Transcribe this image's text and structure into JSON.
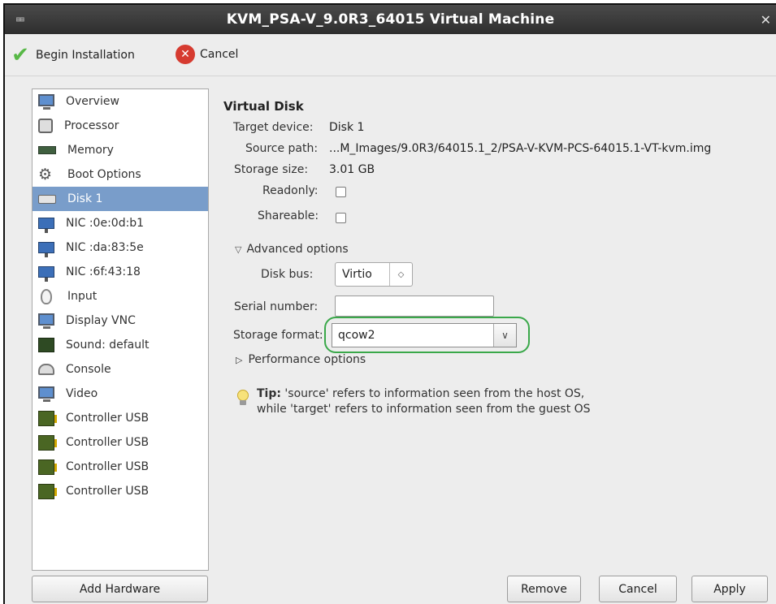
{
  "window": {
    "title": "KVM_PSA-V_9.0R3_64015 Virtual Machine",
    "icon": "window-menu-icon",
    "close_icon": "close-icon"
  },
  "toolbar": {
    "begin_install_label": "Begin Installation",
    "cancel_label": "Cancel"
  },
  "sidebar": {
    "items": [
      {
        "label": "Overview",
        "icon": "monitor-icon"
      },
      {
        "label": "Processor",
        "icon": "processor-icon"
      },
      {
        "label": "Memory",
        "icon": "memory-icon"
      },
      {
        "label": "Boot Options",
        "icon": "gears-icon"
      },
      {
        "label": "Disk 1",
        "icon": "disk-icon",
        "selected": true
      },
      {
        "label": "NIC :0e:0d:b1",
        "icon": "network-icon"
      },
      {
        "label": "NIC :da:83:5e",
        "icon": "network-icon"
      },
      {
        "label": "NIC :6f:43:18",
        "icon": "network-icon"
      },
      {
        "label": "Input",
        "icon": "mouse-icon"
      },
      {
        "label": "Display VNC",
        "icon": "monitor-icon"
      },
      {
        "label": "Sound: default",
        "icon": "sound-icon"
      },
      {
        "label": "Console",
        "icon": "console-icon"
      },
      {
        "label": "Video",
        "icon": "monitor-icon"
      },
      {
        "label": "Controller USB",
        "icon": "controller-icon"
      },
      {
        "label": "Controller USB",
        "icon": "controller-icon"
      },
      {
        "label": "Controller USB",
        "icon": "controller-icon"
      },
      {
        "label": "Controller USB",
        "icon": "controller-icon"
      }
    ],
    "add_hardware_label": "Add Hardware"
  },
  "detail": {
    "section_title": "Virtual Disk",
    "target_device_label": "Target device:",
    "target_device_value": "Disk 1",
    "source_path_label": "Source path:",
    "source_path_value": "...M_Images/9.0R3/64015.1_2/PSA-V-KVM-PCS-64015.1-VT-kvm.img",
    "storage_size_label": "Storage size:",
    "storage_size_value": "3.01 GB",
    "readonly_label": "Readonly:",
    "readonly_checked": false,
    "shareable_label": "Shareable:",
    "shareable_checked": false,
    "advanced_label": "Advanced options",
    "disk_bus_label": "Disk bus:",
    "disk_bus_value": "Virtio",
    "serial_label": "Serial number:",
    "serial_value": "",
    "storage_format_label": "Storage format:",
    "storage_format_value": "qcow2",
    "performance_label": "Performance options",
    "tip_bold": "Tip:",
    "tip_line1": "'source' refers to information seen from the host OS,",
    "tip_line2": "while 'target' refers to information seen from the guest OS"
  },
  "buttons": {
    "remove": "Remove",
    "cancel": "Cancel",
    "apply": "Apply"
  },
  "colors": {
    "selection": "#799dca",
    "highlight_outline": "#3aa84a",
    "titlebar": "#3a3a3a"
  }
}
